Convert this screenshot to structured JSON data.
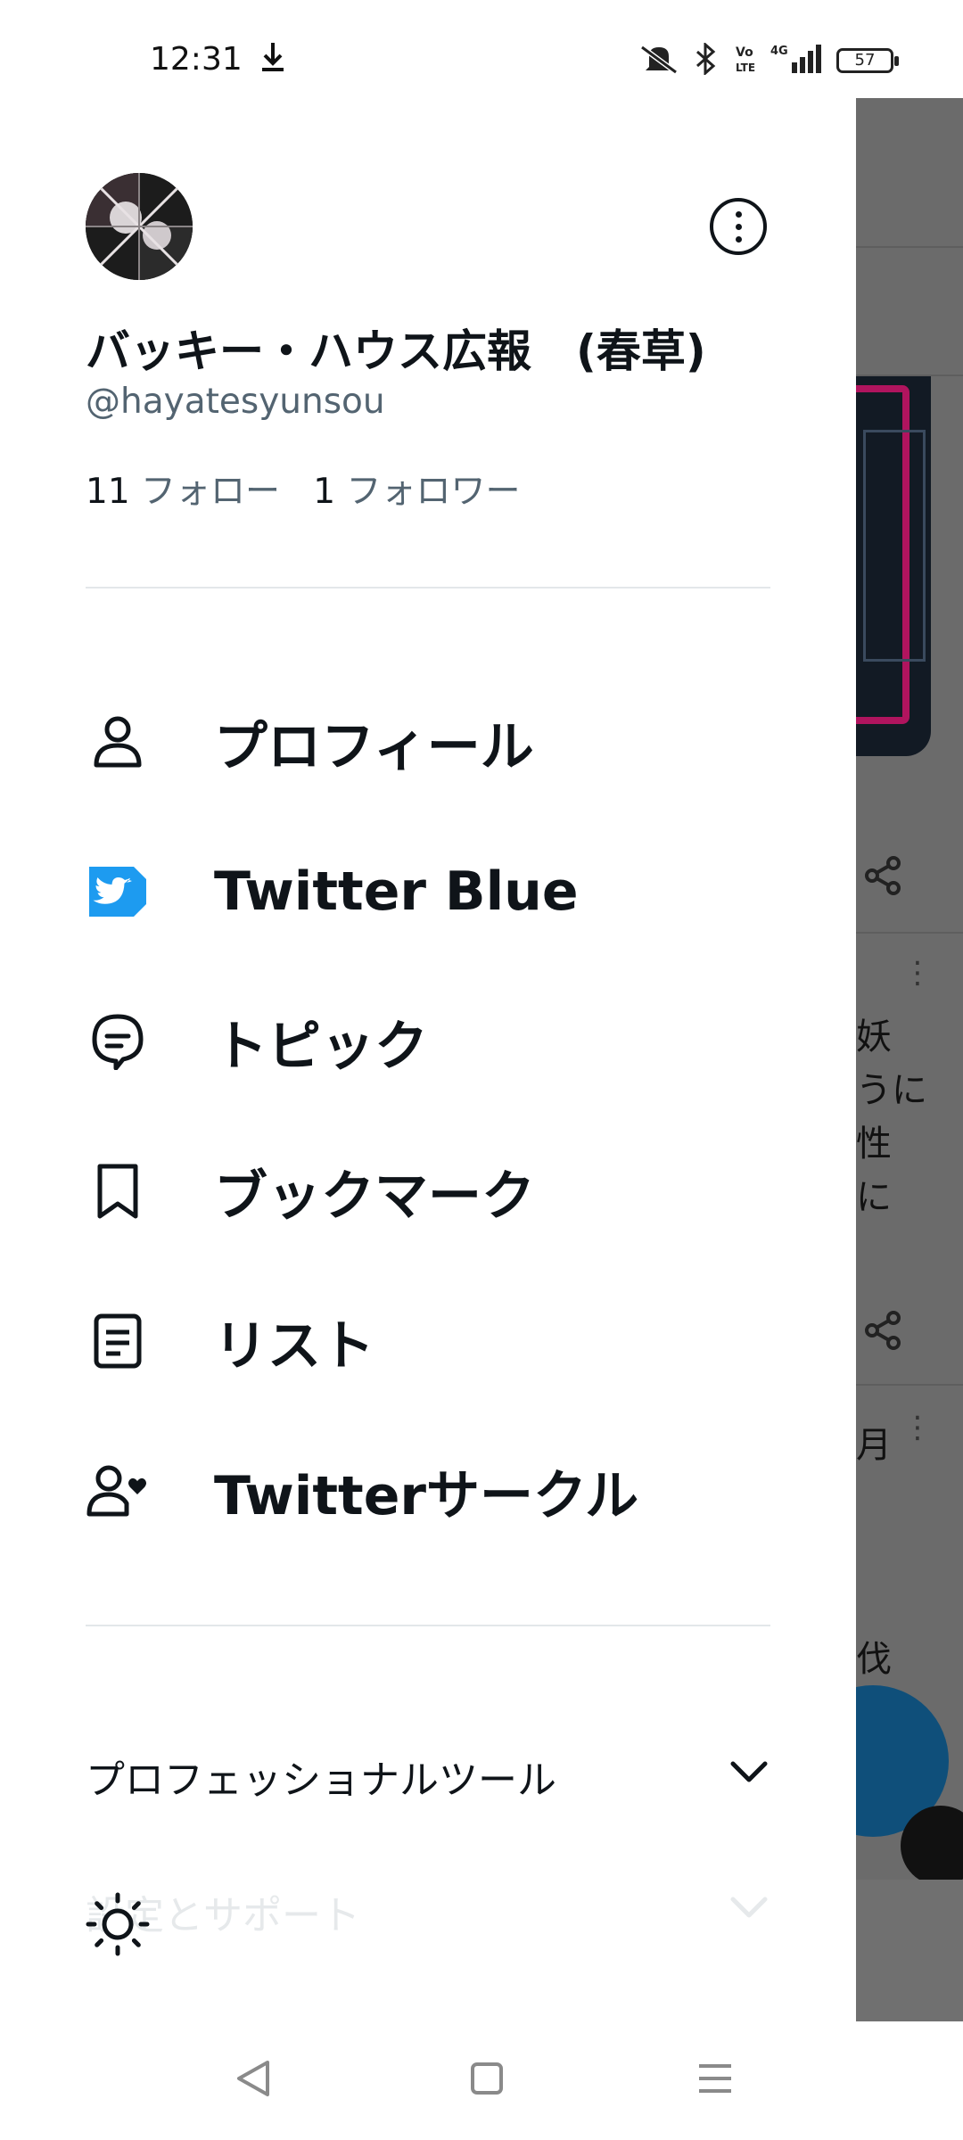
{
  "status_bar": {
    "time": "12:31",
    "battery": "57",
    "icons": [
      "download-icon",
      "mute-icon",
      "bluetooth-icon",
      "volte-icon",
      "4g-signal-icon",
      "battery-icon"
    ]
  },
  "profile": {
    "display_name": "バッキー・ハウス広報　(春草)",
    "handle": "@hayatesyunsou",
    "following_count": "11",
    "following_label": "フォロー",
    "followers_count": "1",
    "followers_label": "フォロワー"
  },
  "menu": {
    "items": [
      {
        "label": "プロフィール",
        "icon": "person-icon"
      },
      {
        "label": "Twitter Blue",
        "icon": "twitter-blue-icon"
      },
      {
        "label": "トピック",
        "icon": "topic-bubble-icon"
      },
      {
        "label": "ブックマーク",
        "icon": "bookmark-icon"
      },
      {
        "label": "リスト",
        "icon": "list-icon"
      },
      {
        "label": "Twitterサークル",
        "icon": "circle-people-icon"
      }
    ]
  },
  "sections": [
    {
      "label": "プロフェッショナルツール",
      "expanded": false
    },
    {
      "label": "設定とサポート",
      "expanded": false
    }
  ],
  "background": {
    "text_lines": [
      "妖",
      "うに",
      "性",
      "に",
      "月",
      "伐"
    ]
  },
  "colors": {
    "text_primary": "#0f1419",
    "text_secondary": "#536471",
    "twitter_blue": "#1d9bf0",
    "overlay": "#6b6b6b"
  }
}
